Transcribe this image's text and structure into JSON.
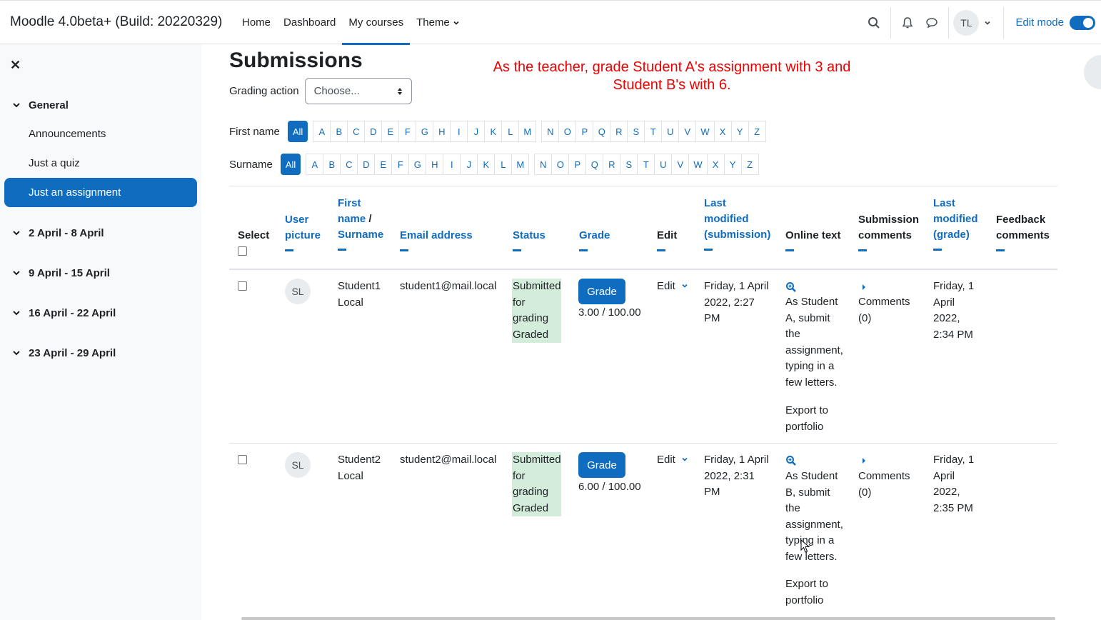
{
  "app": {
    "brand": "Moodle 4.0beta+ (Build: 20220329)",
    "nav": [
      "Home",
      "Dashboard",
      "My courses",
      "Theme"
    ],
    "user_initials": "TL",
    "edit_mode_label": "Edit mode"
  },
  "drawer": {
    "general": "General",
    "items": [
      "Announcements",
      "Just a quiz",
      "Just an assignment"
    ],
    "sections": [
      "2 April - 8 April",
      "9 April - 15 April",
      "16 April - 22 April",
      "23 April - 29 April"
    ]
  },
  "main": {
    "title": "Submissions",
    "grading_action_label": "Grading action",
    "grading_action_value": "Choose...",
    "instruction": "As the teacher, grade Student A's assignment with 3 and Student B's with 6.",
    "first_name_label": "First name",
    "surname_label": "Surname",
    "all_label": "All",
    "letters": [
      "A",
      "B",
      "C",
      "D",
      "E",
      "F",
      "G",
      "H",
      "I",
      "J",
      "K",
      "L",
      "M",
      "N",
      "O",
      "P",
      "Q",
      "R",
      "S",
      "T",
      "U",
      "V",
      "W",
      "X",
      "Y",
      "Z"
    ]
  },
  "table": {
    "headers": {
      "select": "Select",
      "user_picture": "User picture",
      "first_name": "First name",
      "surname": "Surname",
      "email": "Email address",
      "status": "Status",
      "grade": "Grade",
      "edit": "Edit",
      "last_modified_submission": "Last modified (submission)",
      "online_text": "Online text",
      "submission_comments": "Submission comments",
      "last_modified_grade": "Last modified (grade)",
      "feedback_comments": "Feedback comments"
    },
    "rows": [
      {
        "initials": "SL",
        "name": "Student1 Local",
        "email": "student1@mail.local",
        "status": "Submitted for grading Graded",
        "grade_btn": "Grade",
        "grade": "3.00 / 100.00",
        "edit": "Edit",
        "modified": "Friday, 1 April 2022, 2:27 PM",
        "online_text": "As Student A, submit the assignment, typing in a few letters.",
        "export": "Export to portfolio",
        "comments": "Comments (0)",
        "grade_modified": "Friday, 1 April 2022, 2:34 PM"
      },
      {
        "initials": "SL",
        "name": "Student2 Local",
        "email": "student2@mail.local",
        "status": "Submitted for grading Graded",
        "grade_btn": "Grade",
        "grade": "6.00 / 100.00",
        "edit": "Edit",
        "modified": "Friday, 1 April 2022, 2:31 PM",
        "online_text": "As Student B, submit the assignment, typing in a few letters.",
        "export": "Export to portfolio",
        "comments": "Comments (0)",
        "grade_modified": "Friday, 1 April 2022, 2:35 PM"
      }
    ]
  },
  "colors": {
    "accent": "#0f6cbf",
    "status_bg": "#d4edda",
    "instruction": "#ee0000"
  }
}
